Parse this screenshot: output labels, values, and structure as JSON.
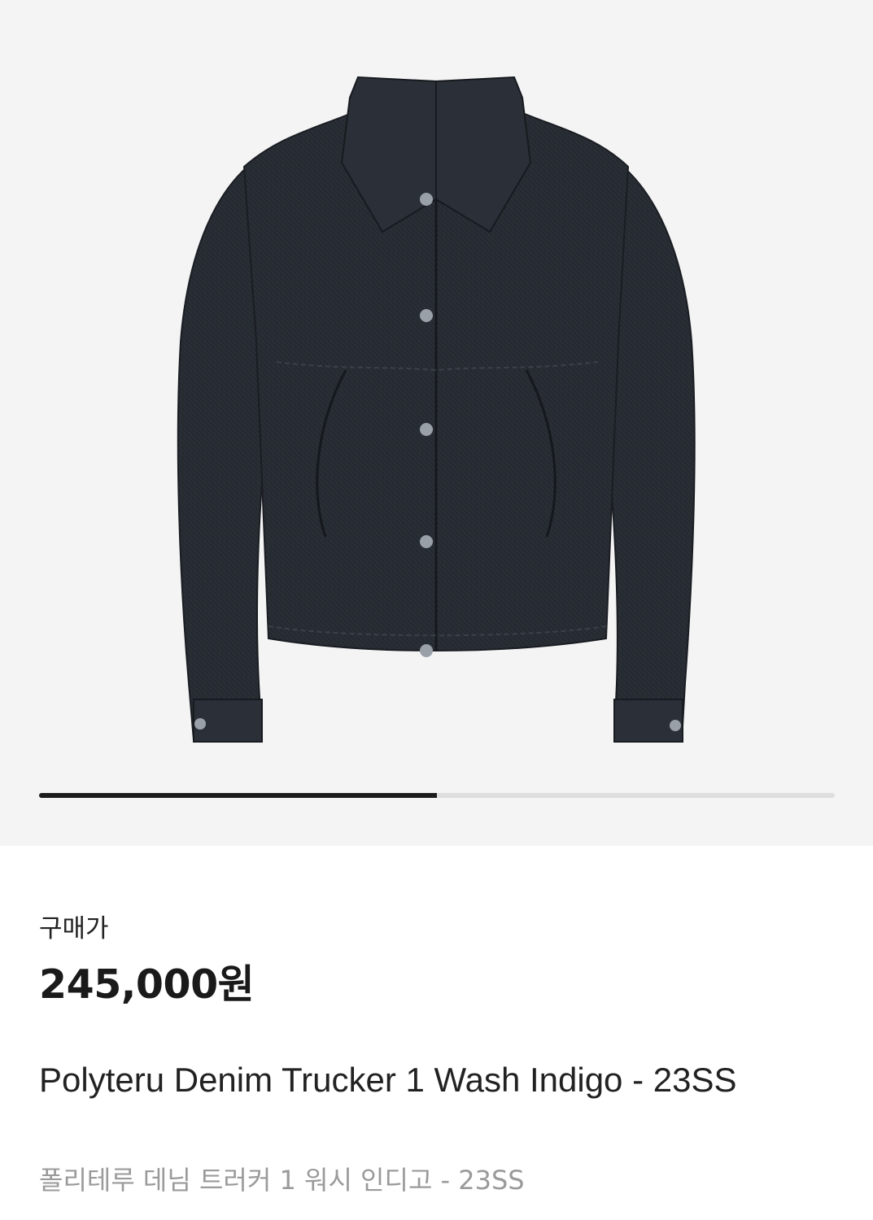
{
  "product": {
    "image_icon": "denim-jacket-image",
    "gallery_progress": 0.5,
    "price_label": "구매가",
    "price": "245,000원",
    "name_en": "Polyteru Denim Trucker 1 Wash Indigo - 23SS",
    "name_ko": "폴리테루 데님 트러커 1 워시 인디고 - 23SS"
  },
  "colors": {
    "image_bg": "#f4f4f5",
    "progress_active": "#1c1c1c",
    "progress_track": "#dedede",
    "jacket_denim": "#262a31"
  }
}
